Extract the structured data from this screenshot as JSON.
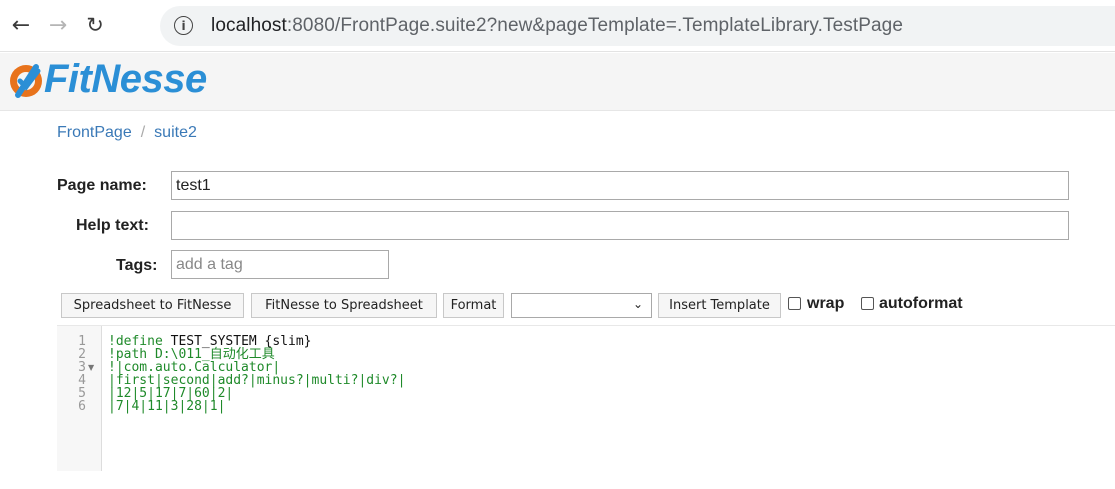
{
  "browser": {
    "back_icon": "arrow-left-icon",
    "forward_icon": "arrow-right-icon",
    "reload_icon": "reload-icon",
    "info_icon": "info-circle-icon",
    "url_host": "localhost",
    "url_rest": ":8080/FrontPage.suite2?new&pageTemplate=.TemplateLibrary.TestPage"
  },
  "header": {
    "logo_text": "FitNesse",
    "brand_color": "#2b8fd6",
    "logo_accent_color": "#e8731c"
  },
  "breadcrumb": {
    "items": [
      "FrontPage",
      "suite2"
    ],
    "separator": "/"
  },
  "form": {
    "page_name_label": "Page name:",
    "page_name_value": "test1",
    "help_text_label": "Help text:",
    "help_text_value": "",
    "tags_label": "Tags:",
    "tags_placeholder": "add a tag"
  },
  "toolbar": {
    "spreadsheet_to_fitnesse": "Spreadsheet to FitNesse",
    "fitnesse_to_spreadsheet": "FitNesse to Spreadsheet",
    "format": "Format",
    "template_select_value": "",
    "insert_template": "Insert Template",
    "wrap_label": "wrap",
    "wrap_checked": false,
    "autoformat_label": "autoformat",
    "autoformat_checked": false
  },
  "editor": {
    "line_numbers": [
      "1",
      "2",
      "3",
      "4",
      "5",
      "6"
    ],
    "lines": [
      {
        "prefix": "!define ",
        "main": "TEST_SYSTEM {slim}"
      },
      {
        "prefix": "!path D:\\011_自动化工具",
        "main": ""
      },
      {
        "prefix": "!|com.auto.Calculator|",
        "main": ""
      },
      {
        "prefix": "|first|second|add?|minus?|multi?|div?|",
        "main": ""
      },
      {
        "prefix": "|12|5|17|7|60|2|",
        "main": ""
      },
      {
        "prefix": "|7|4|11|3|28|1|",
        "main": ""
      }
    ],
    "code_color": "#1f8a2a"
  }
}
